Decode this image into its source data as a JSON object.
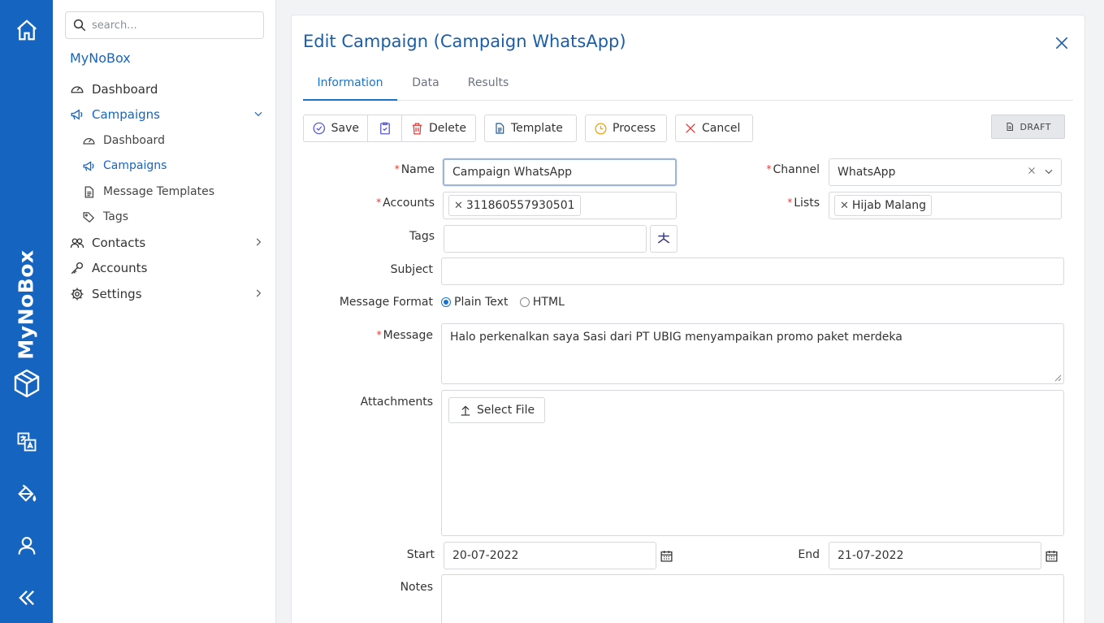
{
  "rail": {
    "brand": "MyNoBox"
  },
  "sidebar": {
    "search_placeholder": "search...",
    "app_name": "MyNoBox",
    "items": {
      "dashboard": "Dashboard",
      "campaigns": "Campaigns",
      "sub_dashboard": "Dashboard",
      "sub_campaigns": "Campaigns",
      "sub_message_templates": "Message Templates",
      "sub_tags": "Tags",
      "contacts": "Contacts",
      "accounts": "Accounts",
      "settings": "Settings"
    }
  },
  "panel": {
    "title": "Edit Campaign (Campaign WhatsApp)",
    "tabs": [
      "Information",
      "Data",
      "Results"
    ],
    "toolbar": {
      "save": "Save",
      "delete": "Delete",
      "template": "Template",
      "process": "Process",
      "cancel": "Cancel",
      "status": "DRAFT"
    },
    "form": {
      "name_label": "Name",
      "name_value": "Campaign WhatsApp",
      "channel_label": "Channel",
      "channel_value": "WhatsApp",
      "accounts_label": "Accounts",
      "accounts_chip": "311860557930501",
      "lists_label": "Lists",
      "lists_chip": "Hijab Malang",
      "tags_label": "Tags",
      "subject_label": "Subject",
      "format_label": "Message Format",
      "format_plain": "Plain Text",
      "format_html": "HTML",
      "message_label": "Message",
      "message_value": "Halo perkenalkan saya Sasi dari PT UBIG menyampaikan promo paket merdeka",
      "attachments_label": "Attachments",
      "select_file": "Select File",
      "start_label": "Start",
      "start_value": "20-07-2022",
      "end_label": "End",
      "end_value": "21-07-2022",
      "notes_label": "Notes"
    }
  },
  "colors": {
    "rail": "#1565c0",
    "accent": "#1a73c8",
    "required": "#e53935"
  }
}
